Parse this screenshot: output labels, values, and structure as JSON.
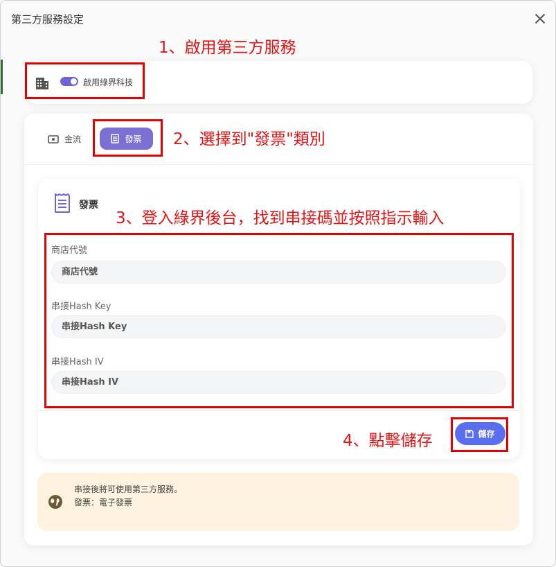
{
  "window": {
    "title": "第三方服務設定"
  },
  "annotations": {
    "step1": "1、啟用第三方服務",
    "step2": "2、選擇到\"發票\"類別",
    "step3": "3、登入綠界後台，找到串接碼並按照指示輸入",
    "step4": "4、點擊儲存"
  },
  "provider": {
    "toggle_label": "啟用綠界科技",
    "enabled": true
  },
  "tabs": [
    {
      "label": "金流",
      "active": false
    },
    {
      "label": "發票",
      "active": true
    }
  ],
  "section": {
    "title": "發票"
  },
  "fields": [
    {
      "label": "商店代號",
      "placeholder": "商店代號",
      "value": ""
    },
    {
      "label": "串接Hash Key",
      "placeholder": "串接Hash Key",
      "value": ""
    },
    {
      "label": "串接Hash IV",
      "placeholder": "串接Hash IV",
      "value": ""
    }
  ],
  "save": {
    "label": "儲存"
  },
  "notice": {
    "line1": "串接後將可使用第三方服務。",
    "line2": "發票：電子發票"
  },
  "colors": {
    "accent": "#7c6fd3",
    "save": "#5a6ef0",
    "annotation": "#e31414",
    "notice_bg": "#fdf3de"
  }
}
